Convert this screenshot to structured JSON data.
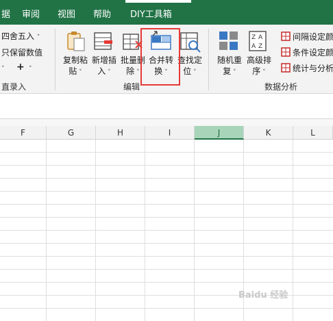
{
  "tabs": [
    "据",
    "审阅",
    "视图",
    "帮助",
    "DIY工具箱"
  ],
  "left_panel": {
    "round_label": "四舍五入",
    "keep_label": "只保留数值",
    "plus_label": "+",
    "group_label": "直录入"
  },
  "edit_group": {
    "buttons": [
      {
        "line1": "复制粘",
        "line2": "贴"
      },
      {
        "line1": "新增插",
        "line2": "入"
      },
      {
        "line1": "批量删",
        "line2": "除"
      },
      {
        "line1": "合并转",
        "line2": "换"
      },
      {
        "line1": "查找定",
        "line2": "位"
      }
    ],
    "group_label": "编辑"
  },
  "analysis_group": {
    "buttons": [
      {
        "line1": "随机重",
        "line2": "复"
      },
      {
        "line1": "高级排",
        "line2": "序"
      }
    ],
    "side_items": [
      "间隔设定颜",
      "条件设定颜",
      "统计与分析"
    ],
    "group_label": "数据分析"
  },
  "columns": [
    {
      "letter": "F",
      "selected": false
    },
    {
      "letter": "G",
      "selected": false
    },
    {
      "letter": "H",
      "selected": false
    },
    {
      "letter": "I",
      "selected": false
    },
    {
      "letter": "J",
      "selected": true
    },
    {
      "letter": "K",
      "selected": false
    },
    {
      "letter": "L",
      "selected": false
    }
  ],
  "watermark": "Baidu 经验",
  "colors": {
    "accent": "#217346",
    "highlight": "#e53935",
    "selected_col": "#a8d5ba"
  }
}
